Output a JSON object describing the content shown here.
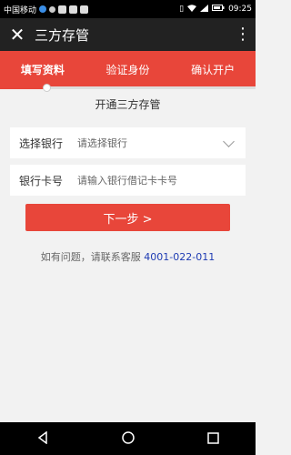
{
  "status_bar": {
    "carrier": "中国移动",
    "time": "09:25"
  },
  "app_bar": {
    "title": "三方存管",
    "close_icon": "close-icon",
    "menu_icon": "more-vertical-icon"
  },
  "steps": [
    {
      "label": "填写资料",
      "active": true
    },
    {
      "label": "验证身份",
      "active": false
    },
    {
      "label": "确认开户",
      "active": false
    }
  ],
  "section": {
    "title": "开通三方存管"
  },
  "form": {
    "bank": {
      "label": "选择银行",
      "placeholder": "请选择银行"
    },
    "card": {
      "label": "银行卡号",
      "placeholder": "请输入银行借记卡卡号"
    }
  },
  "next_button": {
    "label": "下一步 >"
  },
  "contact": {
    "text": "如有问题，请联系客服 ",
    "phone": "4001-022-011"
  },
  "colors": {
    "accent": "#e8463a",
    "app_bar": "#222222",
    "link": "#1e3bb3"
  }
}
